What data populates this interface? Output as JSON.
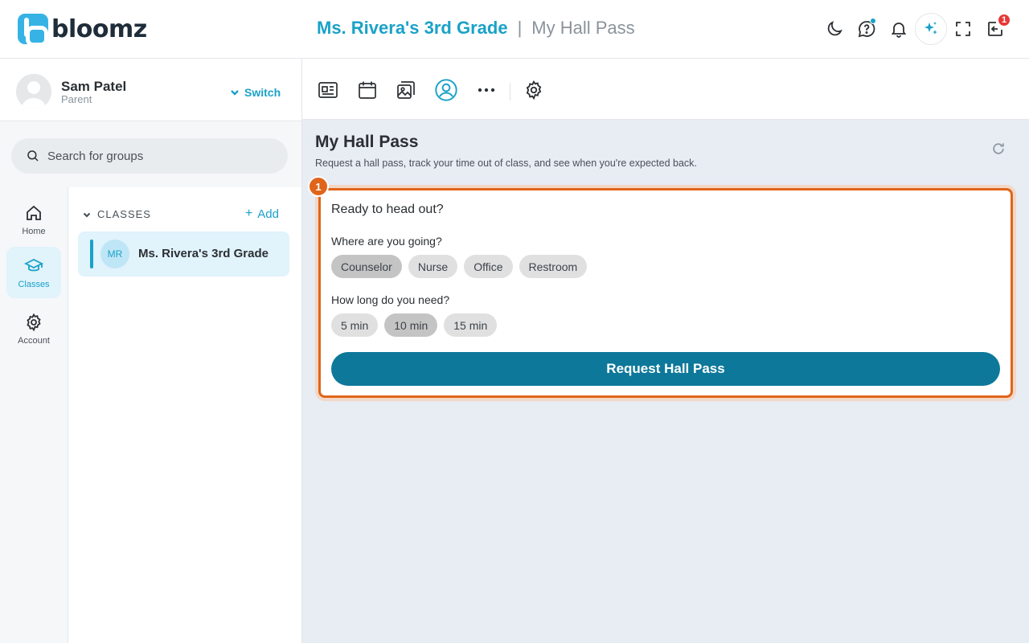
{
  "app": {
    "logo_text": "bloomz"
  },
  "header": {
    "group_title": "Ms. Rivera's 3rd Grade",
    "separator": "|",
    "page_title": "My Hall Pass",
    "icons": [
      "moon-icon",
      "help-chat-icon",
      "bell-icon",
      "ai-sparkle-icon",
      "fullscreen-icon",
      "inbox-icon"
    ],
    "help_has_dot": true,
    "inbox_badge": "1",
    "accent_color": "#1aa2c8",
    "badge_color": "#e53935"
  },
  "user": {
    "name": "Sam Patel",
    "role": "Parent",
    "switch_label": "Switch"
  },
  "search": {
    "placeholder": "Search for groups"
  },
  "rail": {
    "items": [
      {
        "label": "Home",
        "icon": "home-icon",
        "active": false
      },
      {
        "label": "Classes",
        "icon": "graduation-cap-icon",
        "active": true
      },
      {
        "label": "Account",
        "icon": "gear-icon",
        "active": false
      }
    ]
  },
  "groups": {
    "section_label": "CLASSES",
    "add_label": "Add",
    "classes": [
      {
        "initials": "MR",
        "name": "Ms. Rivera's 3rd Grade",
        "selected": true
      }
    ]
  },
  "toolbar": {
    "tools": [
      "news-feed-icon",
      "calendar-icon",
      "photos-icon",
      "user-circle-icon",
      "more-icon",
      "settings-icon"
    ],
    "active_tool": "user-circle-icon"
  },
  "main": {
    "title": "My Hall Pass",
    "subtitle": "Request a hall pass, track your time out of class, and see when you're expected back.",
    "step_badge": "1",
    "highlight_color": "#e0651b",
    "card": {
      "heading": "Ready to head out?",
      "destination_label": "Where are you going?",
      "destinations": [
        {
          "label": "Counselor",
          "selected": true
        },
        {
          "label": "Nurse",
          "selected": false
        },
        {
          "label": "Office",
          "selected": false
        },
        {
          "label": "Restroom",
          "selected": false
        }
      ],
      "duration_label": "How long do you need?",
      "durations": [
        {
          "label": "5 min",
          "selected": false
        },
        {
          "label": "10 min",
          "selected": true
        },
        {
          "label": "15 min",
          "selected": false
        }
      ],
      "submit_label": "Request Hall Pass",
      "submit_color": "#0d789a"
    }
  }
}
